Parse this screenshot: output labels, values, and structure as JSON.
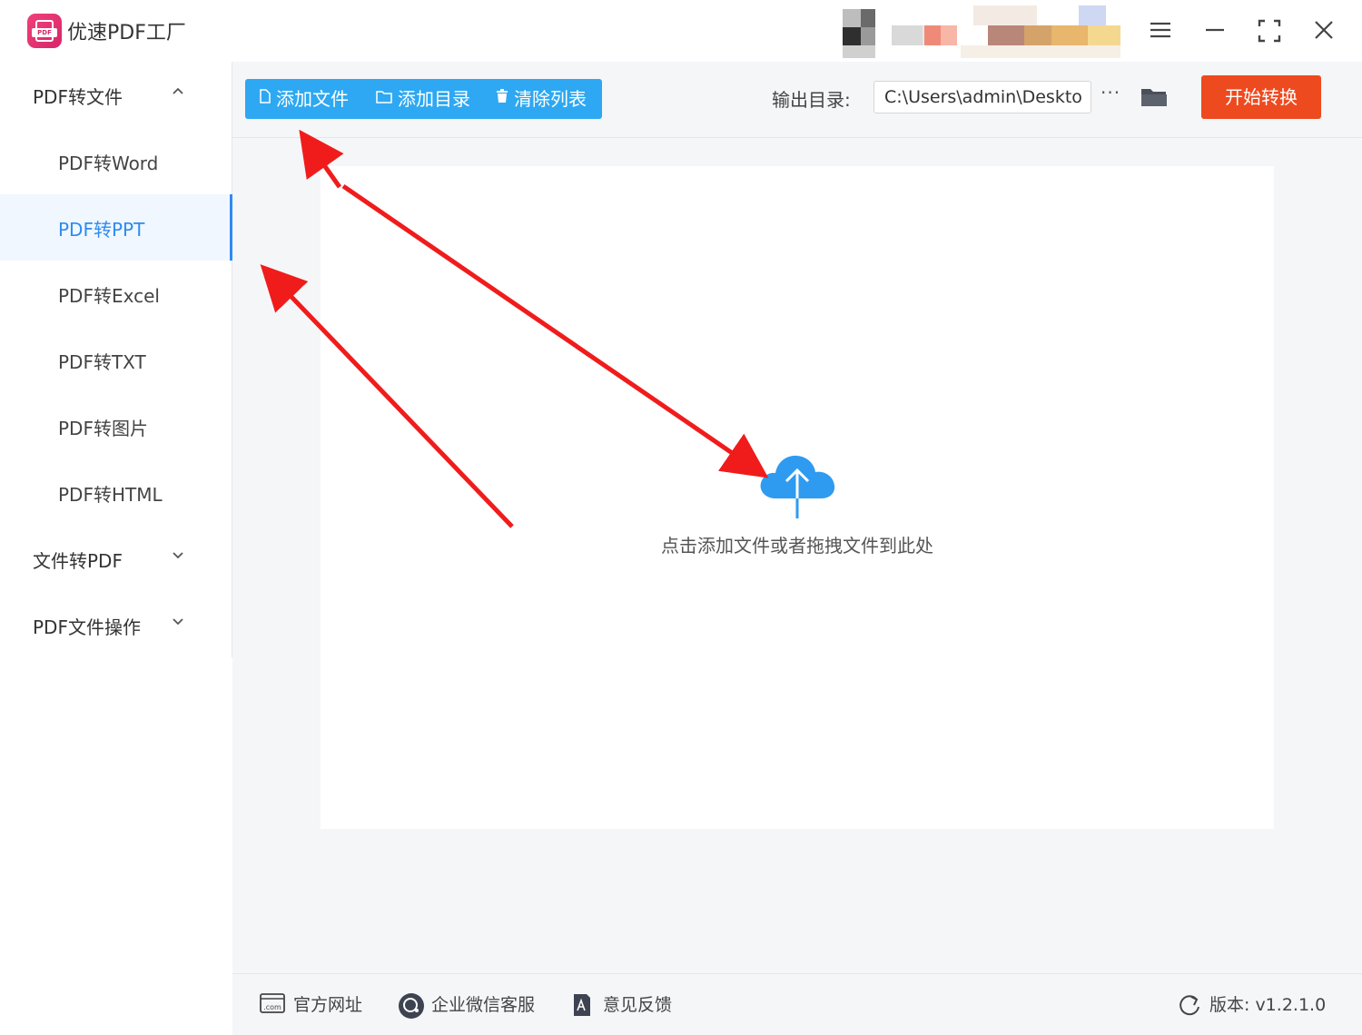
{
  "app": {
    "title": "优速PDF工厂",
    "logo_text": "PDF"
  },
  "window": {
    "menu_icon": "hamburger-icon",
    "minimize_icon": "minimize-icon",
    "maximize_icon": "maximize-icon",
    "close_icon": "close-icon"
  },
  "sidebar": {
    "groups": [
      {
        "label": "PDF转文件",
        "expanded": true,
        "items": [
          {
            "label": "PDF转Word",
            "active": false
          },
          {
            "label": "PDF转PPT",
            "active": true
          },
          {
            "label": "PDF转Excel",
            "active": false
          },
          {
            "label": "PDF转TXT",
            "active": false
          },
          {
            "label": "PDF转图片",
            "active": false
          },
          {
            "label": "PDF转HTML",
            "active": false
          }
        ]
      },
      {
        "label": "文件转PDF",
        "expanded": false
      },
      {
        "label": "PDF文件操作",
        "expanded": false
      }
    ]
  },
  "toolbar": {
    "add_file": "添加文件",
    "add_folder": "添加目录",
    "clear_list": "清除列表",
    "output_label": "输出目录:",
    "output_path": "C:\\Users\\admin\\Deskto",
    "more": "···",
    "start": "开始转换"
  },
  "dropzone": {
    "hint": "点击添加文件或者拖拽文件到此处"
  },
  "footer": {
    "website": "官方网址",
    "wechat_support": "企业微信客服",
    "feedback": "意见反馈",
    "version": "版本: v1.2.1.0"
  },
  "colors": {
    "accent_blue": "#2e8cf0",
    "toolbar_blue": "#2ea8f2",
    "start_red": "#ee4a1f",
    "logo_pink": "#e8306f",
    "annotation_red": "#f01c1c"
  }
}
